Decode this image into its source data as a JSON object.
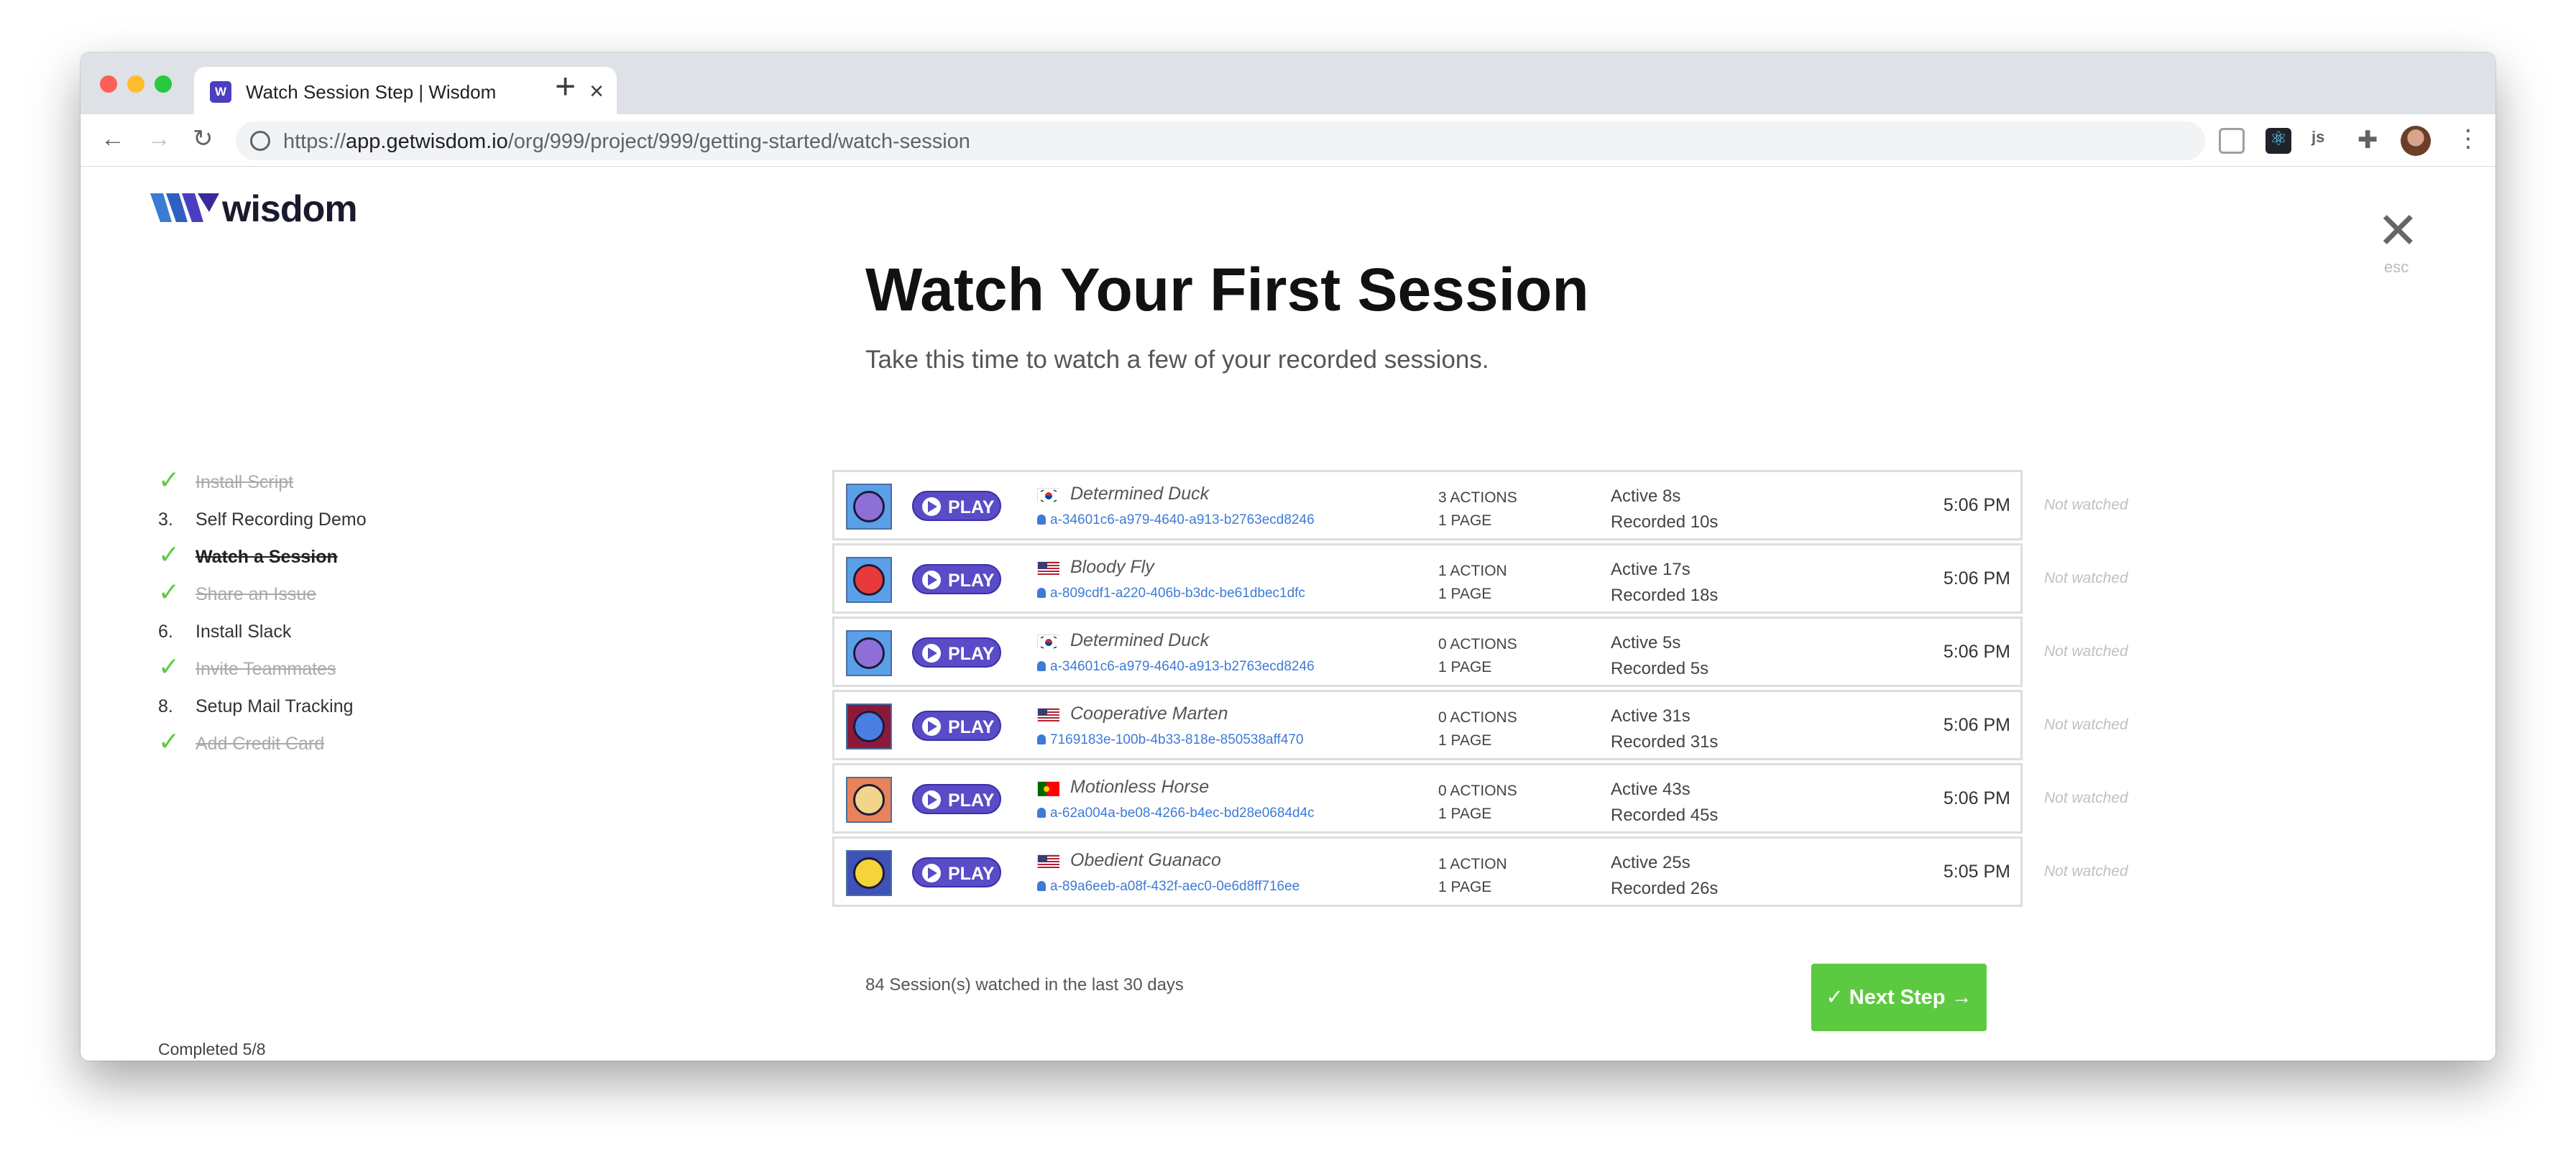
{
  "browser": {
    "tab_title": "Watch Session Step | Wisdom",
    "favicon_letter": "W",
    "url_prefix": "https://",
    "url_host": "app.getwisdom.io",
    "url_path": "/org/999/project/999/getting-started/watch-session",
    "ext_js_label": "js"
  },
  "app": {
    "logo_text": "wisdom",
    "close_label": "esc"
  },
  "main": {
    "title": "Watch Your First Session",
    "subtitle": "Take this time to watch a few of your recorded sessions.",
    "watched_count": "84 Session(s) watched in the last 30 days",
    "next_button": "✓ Next Step →"
  },
  "steps": [
    {
      "marker": "✓",
      "label": "Install Script",
      "state": "done"
    },
    {
      "marker": "3.",
      "label": "Self Recording Demo",
      "state": "todo"
    },
    {
      "marker": "✓",
      "label": "Watch a Session",
      "state": "current"
    },
    {
      "marker": "✓",
      "label": "Share an Issue",
      "state": "done"
    },
    {
      "marker": "6.",
      "label": "Install Slack",
      "state": "todo"
    },
    {
      "marker": "✓",
      "label": "Invite Teammates",
      "state": "done"
    },
    {
      "marker": "8.",
      "label": "Setup Mail Tracking",
      "state": "todo"
    },
    {
      "marker": "✓",
      "label": "Add Credit Card",
      "state": "done"
    }
  ],
  "progress": {
    "label": "Completed 5/8",
    "fraction": 0.625
  },
  "sessions": [
    {
      "name": "Determined Duck",
      "user": "a-34601c6-a979-4640-a913-b2763ecd8246",
      "actions": "3 ACTIONS",
      "pages": "1 PAGE",
      "active": "Active 8s",
      "recorded": "Recorded 10s",
      "time": "5:06 PM",
      "status": "Not watched",
      "play": "PLAY",
      "flag": "kr",
      "avatar_color": "#5aa0e8",
      "face_color": "#8e6fd8"
    },
    {
      "name": "Bloody Fly",
      "user": "a-809cdf1-a220-406b-b3dc-be61dbec1dfc",
      "actions": "1 ACTION",
      "pages": "1 PAGE",
      "active": "Active 17s",
      "recorded": "Recorded 18s",
      "time": "5:06 PM",
      "status": "Not watched",
      "play": "PLAY",
      "flag": "us",
      "avatar_color": "#5aa0e8",
      "face_color": "#e83a3a"
    },
    {
      "name": "Determined Duck",
      "user": "a-34601c6-a979-4640-a913-b2763ecd8246",
      "actions": "0 ACTIONS",
      "pages": "1 PAGE",
      "active": "Active 5s",
      "recorded": "Recorded 5s",
      "time": "5:06 PM",
      "status": "Not watched",
      "play": "PLAY",
      "flag": "kr",
      "avatar_color": "#5aa0e8",
      "face_color": "#8e6fd8"
    },
    {
      "name": "Cooperative Marten",
      "user": "7169183e-100b-4b33-818e-850538aff470",
      "actions": "0 ACTIONS",
      "pages": "1 PAGE",
      "active": "Active 31s",
      "recorded": "Recorded 31s",
      "time": "5:06 PM",
      "status": "Not watched",
      "play": "PLAY",
      "flag": "us",
      "avatar_color": "#8b1a3a",
      "face_color": "#4a7ee0"
    },
    {
      "name": "Motionless Horse",
      "user": "a-62a004a-be08-4266-b4ec-bd28e0684d4c",
      "actions": "0 ACTIONS",
      "pages": "1 PAGE",
      "active": "Active 43s",
      "recorded": "Recorded 45s",
      "time": "5:06 PM",
      "status": "Not watched",
      "play": "PLAY",
      "flag": "pt",
      "avatar_color": "#e8825a",
      "face_color": "#f2d48a"
    },
    {
      "name": "Obedient Guanaco",
      "user": "a-89a6eeb-a08f-432f-aec0-0e6d8ff716ee",
      "actions": "1 ACTION",
      "pages": "1 PAGE",
      "active": "Active 25s",
      "recorded": "Recorded 26s",
      "time": "5:05 PM",
      "status": "Not watched",
      "play": "PLAY",
      "flag": "us",
      "avatar_color": "#3f52b5",
      "face_color": "#f5d33a"
    }
  ]
}
